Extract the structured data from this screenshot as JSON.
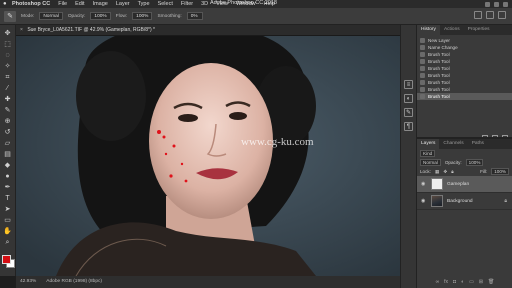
{
  "menubar": {
    "app_name": "Photoshop CC",
    "items": [
      "File",
      "Edit",
      "Image",
      "Layer",
      "Type",
      "Select",
      "Filter",
      "3D",
      "View",
      "Window",
      "Help"
    ]
  },
  "options": {
    "mode_label": "Mode:",
    "mode_value": "Normal",
    "opacity_label": "Opacity:",
    "opacity_value": "100%",
    "flow_label": "Flow:",
    "flow_value": "100%",
    "smoothing_label": "Smoothing:",
    "smoothing_value": "0%"
  },
  "window_title": "Adobe Photoshop CC 2018",
  "document": {
    "tab_title": "Sue Bryce_L0A5621.TIF @ 42.9% (Gameplan, RGB/8*) *",
    "close_glyph": "×"
  },
  "canvas_watermark": "www.cg-ku.com",
  "status": {
    "zoom": "42.93%",
    "profile": "Adobe RGB (1998) (8bpc)"
  },
  "colors": {
    "foreground": "#d40d12",
    "background": "#ffffff",
    "accent": "#5a5a5a"
  },
  "history_panel": {
    "tabs": [
      "History",
      "Actions",
      "Properties"
    ],
    "active_tab": "History",
    "items": [
      "New Layer",
      "Name Change",
      "Brush Tool",
      "Brush Tool",
      "Brush Tool",
      "Brush Tool",
      "Brush Tool",
      "Brush Tool",
      "Brush Tool"
    ],
    "selected_index": 8
  },
  "layers_panel": {
    "tabs": [
      "Layers",
      "Channels",
      "Paths"
    ],
    "active_tab": "Layers",
    "kind_label": "Kind",
    "blend_mode": "Normal",
    "opacity_label": "Opacity:",
    "opacity_value": "100%",
    "lock_label": "Lock:",
    "fill_label": "Fill:",
    "fill_value": "100%",
    "layers": [
      {
        "name": "Gameplan",
        "selected": true
      },
      {
        "name": "Background",
        "selected": false
      }
    ]
  },
  "icons": {
    "toolbar": [
      "move-icon",
      "marquee-icon",
      "lasso-icon",
      "quick-select-icon",
      "crop-icon",
      "eyedropper-icon",
      "healing-icon",
      "brush-icon",
      "clone-icon",
      "history-brush-icon",
      "eraser-icon",
      "gradient-icon",
      "blur-icon",
      "dodge-icon",
      "pen-icon",
      "type-icon",
      "path-select-icon",
      "shape-icon",
      "hand-icon",
      "zoom-icon"
    ]
  }
}
